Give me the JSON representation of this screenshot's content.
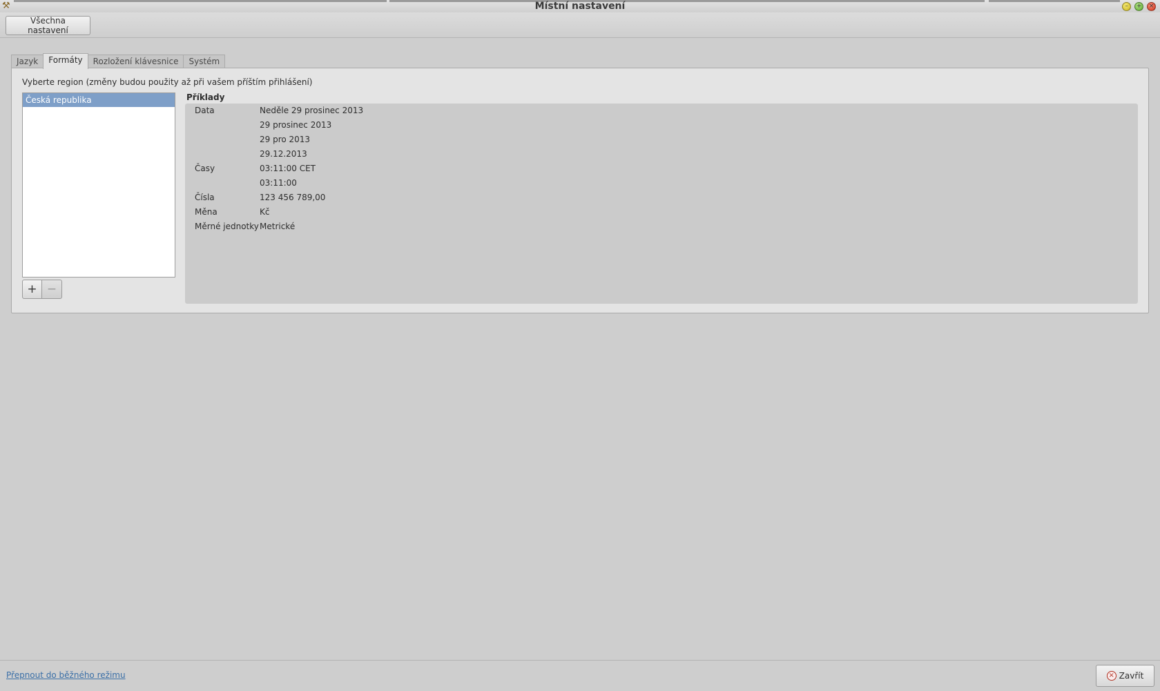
{
  "window": {
    "title": "Místní nastavení",
    "app_icon": "tools-icon",
    "minimize": "–",
    "maximize": "+",
    "close": "×"
  },
  "toolbar": {
    "all_settings_label": "Všechna nastavení"
  },
  "tabs": [
    {
      "label": "Jazyk",
      "active": false
    },
    {
      "label": "Formáty",
      "active": true
    },
    {
      "label": "Rozložení klávesnice",
      "active": false
    },
    {
      "label": "Systém",
      "active": false
    }
  ],
  "formats": {
    "hint": "Vyberte region (změny budou použity až při vašem příštím přihlášení)",
    "regions": [
      "Česká republika"
    ],
    "selected_region": "Česká republika",
    "add_label": "+",
    "remove_label": "−",
    "examples_title": "Příklady",
    "examples": [
      {
        "key": "Data",
        "value": "Neděle 29 prosinec 2013"
      },
      {
        "key": "",
        "value": "29 prosinec 2013"
      },
      {
        "key": "",
        "value": "29 pro 2013"
      },
      {
        "key": "",
        "value": "29.12.2013"
      },
      {
        "key": "Časy",
        "value": "03:11:00 CET"
      },
      {
        "key": "",
        "value": "03:11:00"
      },
      {
        "key": "Čísla",
        "value": "123 456 789,00"
      },
      {
        "key": "Měna",
        "value": "Kč"
      },
      {
        "key": "Měrné jednotky",
        "value": "Metrické"
      }
    ]
  },
  "footer": {
    "mode_link": "Přepnout do běžného režimu",
    "close_label": "Zavřít",
    "close_icon": "×"
  },
  "colors": {
    "selection": "#7e9fc8",
    "link": "#3a6fa7",
    "background": "#cecece"
  }
}
